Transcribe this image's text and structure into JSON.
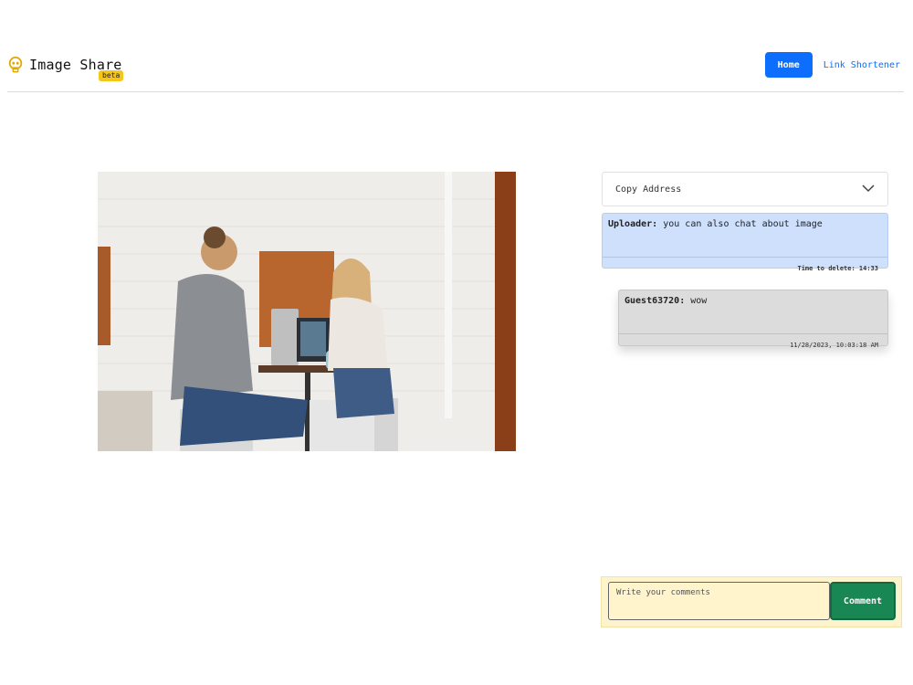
{
  "header": {
    "brand": "Image Share",
    "badge": "beta",
    "nav": {
      "home": "Home",
      "link_shortener": "Link Shortener"
    }
  },
  "copy_address": {
    "label": "Copy Address"
  },
  "messages": [
    {
      "author": "Uploader:",
      "text": "you can also chat about image",
      "meta": "Time to delete: 14:33"
    },
    {
      "author": "Guest63720:",
      "text": "wow",
      "meta": "11/28/2023, 10:03:18 AM"
    }
  ],
  "comment": {
    "placeholder": "Write your comments",
    "button": "Comment"
  },
  "colors": {
    "primary": "#0d6efd",
    "success": "#198754",
    "badge": "#f5c518",
    "uploader_bg": "#cfe0fd",
    "guest_bg": "#dcdcdc",
    "comment_bg": "#fdf3cd"
  }
}
